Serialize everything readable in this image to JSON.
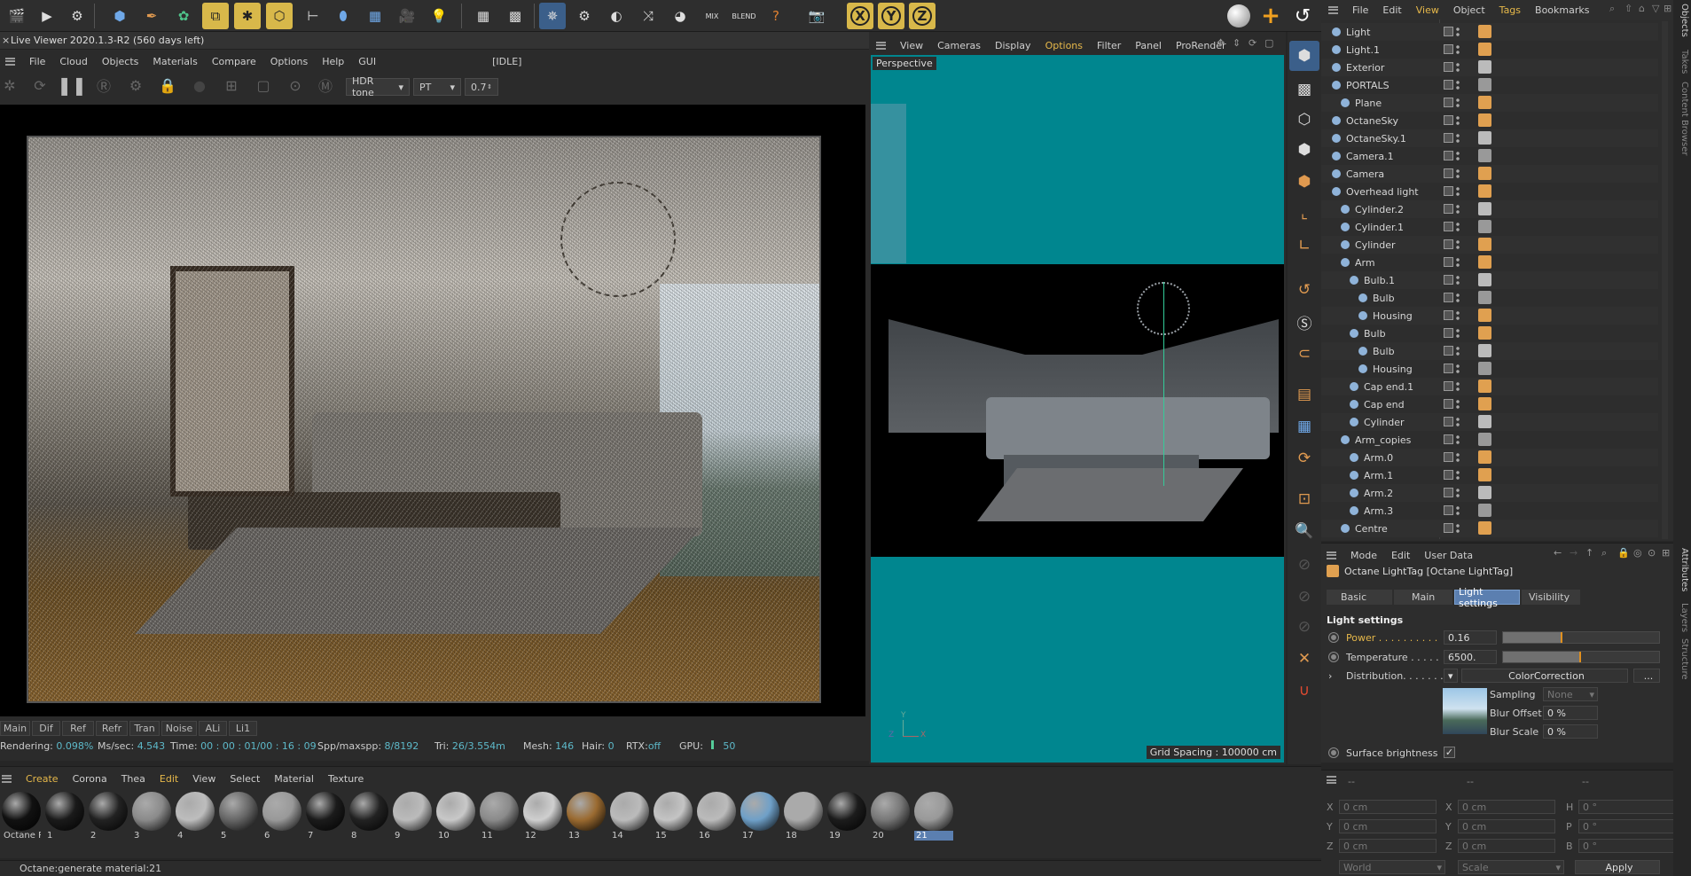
{
  "toolbar": {
    "xyz": [
      "X",
      "Y",
      "Z"
    ],
    "mix": "MIX",
    "blend": "BLEND"
  },
  "right_menu": [
    "File",
    "Edit",
    "View",
    "Object",
    "Tags",
    "Bookmarks"
  ],
  "live_viewer": {
    "title": "Live Viewer 2020.1.3-R2 (560 days left)",
    "menu": [
      "File",
      "Cloud",
      "Objects",
      "Materials",
      "Compare",
      "Options",
      "Help",
      "GUI"
    ],
    "status": "[IDLE]",
    "tone": "HDR tone",
    "kernel": "PT",
    "value": "0.7",
    "passes": [
      "Main",
      "Dif",
      "Ref",
      "Refr",
      "Tran",
      "Noise",
      "ALi",
      "Li1"
    ],
    "stats": {
      "rendering_label": "Rendering:",
      "rendering_val": "0.098%",
      "ms_label": "Ms/sec:",
      "ms_val": "4.543",
      "time_label": "Time:",
      "time_val": "00 : 00 : 01/00 : 16 : 09",
      "spp_label": "Spp/maxspp:",
      "spp_val": "8/8192",
      "tri_label": "Tri:",
      "tri_val": "26/3.554m",
      "mesh_label": "Mesh:",
      "mesh_val": "146",
      "hair_label": "Hair:",
      "hair_val": "0",
      "rtx_label": "RTX:",
      "rtx_val": "off",
      "gpu_label": "GPU:",
      "gpu_val": "50"
    }
  },
  "viewport": {
    "menu": [
      "View",
      "Cameras",
      "Display",
      "Options",
      "Filter",
      "Panel",
      "ProRender"
    ],
    "label": "Perspective",
    "grid": "Grid Spacing : 100000 cm",
    "axis_y": "Y",
    "axis_x": "X",
    "axis_z": "Z"
  },
  "objects": [
    {
      "name": "Light",
      "indent": 0
    },
    {
      "name": "Light.1",
      "indent": 0
    },
    {
      "name": "Exterior",
      "indent": 0
    },
    {
      "name": "PORTALS",
      "indent": 0
    },
    {
      "name": "Plane",
      "indent": 1
    },
    {
      "name": "OctaneSky",
      "indent": 0
    },
    {
      "name": "OctaneSky.1",
      "indent": 0
    },
    {
      "name": "Camera.1",
      "indent": 0
    },
    {
      "name": "Camera",
      "indent": 0
    },
    {
      "name": "Overhead light",
      "indent": 0
    },
    {
      "name": "Cylinder.2",
      "indent": 1
    },
    {
      "name": "Cylinder.1",
      "indent": 1
    },
    {
      "name": "Cylinder",
      "indent": 1
    },
    {
      "name": "Arm",
      "indent": 1
    },
    {
      "name": "Bulb.1",
      "indent": 2
    },
    {
      "name": "Bulb",
      "indent": 3
    },
    {
      "name": "Housing",
      "indent": 3
    },
    {
      "name": "Bulb",
      "indent": 2
    },
    {
      "name": "Bulb",
      "indent": 3
    },
    {
      "name": "Housing",
      "indent": 3
    },
    {
      "name": "Cap end.1",
      "indent": 2
    },
    {
      "name": "Cap end",
      "indent": 2
    },
    {
      "name": "Cylinder",
      "indent": 2
    },
    {
      "name": "Arm_copies",
      "indent": 1
    },
    {
      "name": "Arm.0",
      "indent": 2
    },
    {
      "name": "Arm.1",
      "indent": 2
    },
    {
      "name": "Arm.2",
      "indent": 2
    },
    {
      "name": "Arm.3",
      "indent": 2
    },
    {
      "name": "Centre",
      "indent": 1
    }
  ],
  "attributes": {
    "menu": [
      "Mode",
      "Edit",
      "User Data"
    ],
    "title": "Octane LightTag [Octane LightTag]",
    "tabs": [
      "Basic",
      "Main",
      "Light settings",
      "Visibility"
    ],
    "section": "Light settings",
    "power_label": "Power . . . . . . . . . .",
    "power_val": "0.16",
    "power_fill": 0.38,
    "temp_label": "Temperature . . . . .",
    "temp_val": "6500.",
    "temp_fill": 0.5,
    "dist_label": "Distribution. . . . . . .",
    "dist_btn": "ColorCorrection",
    "dist_more": "...",
    "sampling_label": "Sampling",
    "sampling_val": "None",
    "blur_offset_label": "Blur Offset",
    "blur_offset_val": "0 %",
    "blur_scale_label": "Blur Scale",
    "blur_scale_val": "0 %",
    "surface_label": "Surface brightness"
  },
  "materials": {
    "menu": [
      "Create",
      "Corona",
      "Thea",
      "Edit",
      "View",
      "Select",
      "Material",
      "Texture"
    ],
    "items": [
      "Octane P",
      "1",
      "2",
      "3",
      "4",
      "5",
      "6",
      "7",
      "8",
      "9",
      "10",
      "11",
      "12",
      "13",
      "14",
      "15",
      "16",
      "17",
      "18",
      "19",
      "20",
      "21"
    ]
  },
  "coords": {
    "head": [
      "--",
      "--",
      "--"
    ],
    "rows": [
      [
        "X",
        "0 cm",
        "X",
        "0 cm",
        "H",
        "0 °"
      ],
      [
        "Y",
        "0 cm",
        "Y",
        "0 cm",
        "P",
        "0 °"
      ],
      [
        "Z",
        "0 cm",
        "Z",
        "0 cm",
        "B",
        "0 °"
      ]
    ],
    "world": "World",
    "scale": "Scale",
    "apply": "Apply"
  },
  "side_tabs": {
    "top": [
      "Objects",
      "Takes",
      "Content Browser"
    ],
    "bottom": [
      "Attributes",
      "Layers",
      "Structure"
    ]
  },
  "status_bar": "Octane:generate material:21"
}
